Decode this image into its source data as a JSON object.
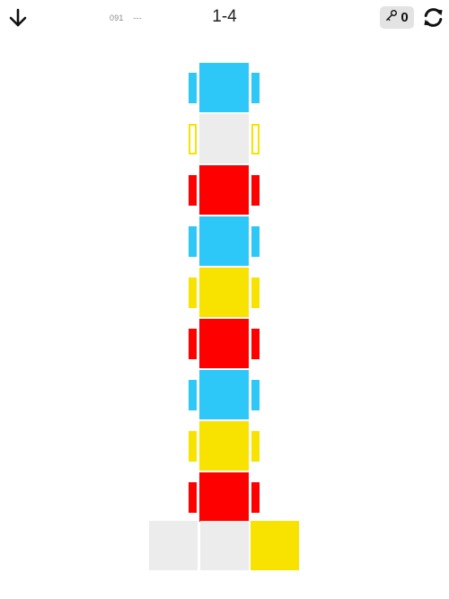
{
  "header": {
    "counter_number": "091",
    "counter_extra": "---",
    "level": "1-4",
    "keys": "0"
  },
  "icons": {
    "down": "arrow-down-icon",
    "key": "key-icon",
    "refresh": "refresh-icon"
  },
  "colors": {
    "blue": "#2ec8f8",
    "red": "#ff0000",
    "yellow": "#f7e200",
    "empty": "#ececec",
    "empty_tab_border": "#f7e200"
  },
  "tower": {
    "blocks": [
      {
        "color": "blue",
        "tabs": "solid"
      },
      {
        "color": "empty",
        "tabs": "outline-yellow"
      },
      {
        "color": "red",
        "tabs": "solid"
      },
      {
        "color": "blue",
        "tabs": "solid"
      },
      {
        "color": "yellow",
        "tabs": "solid"
      },
      {
        "color": "red",
        "tabs": "solid"
      },
      {
        "color": "blue",
        "tabs": "solid"
      },
      {
        "color": "yellow",
        "tabs": "solid"
      },
      {
        "color": "red",
        "tabs": "solid"
      }
    ]
  },
  "base_slots": [
    "empty",
    "empty",
    "yellow"
  ]
}
